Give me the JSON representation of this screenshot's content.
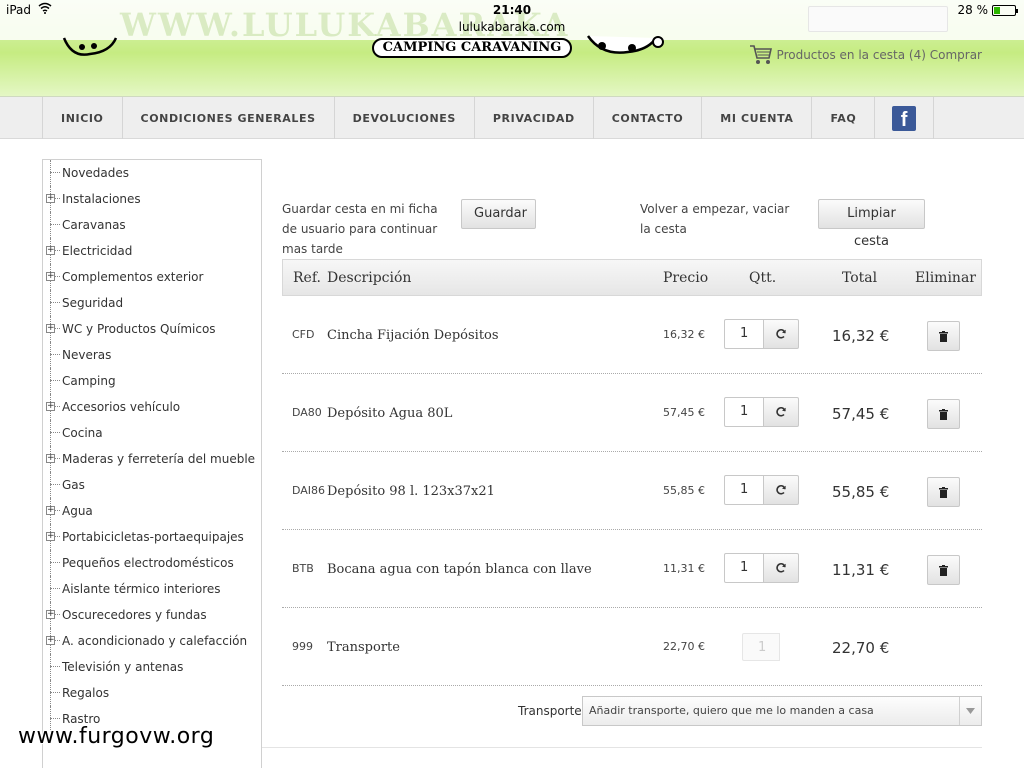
{
  "status_bar": {
    "device": "iPad",
    "time": "21:40",
    "url": "lulukabaraka.com",
    "battery_text": "28 %",
    "battery_level": 0.28,
    "battery_color": "#2db600"
  },
  "header": {
    "domain_banner": "WWW.LULUKABARAKA",
    "logo_subtitle": "CAMPING CARAVANING",
    "cart_text": "Productos en la cesta (4) Comprar",
    "cart_icon": "shopping-cart-icon"
  },
  "nav": {
    "items": [
      "INICIO",
      "CONDICIONES GENERALES",
      "DEVOLUCIONES",
      "PRIVACIDAD",
      "CONTACTO",
      "MI CUENTA",
      "FAQ"
    ],
    "facebook_icon": "facebook-icon",
    "facebook_color": "#3b5998"
  },
  "sidebar": {
    "categories": [
      {
        "label": "Novedades",
        "expandable": false
      },
      {
        "label": "Instalaciones",
        "expandable": true
      },
      {
        "label": "Caravanas",
        "expandable": false
      },
      {
        "label": "Electricidad",
        "expandable": true
      },
      {
        "label": "Complementos exterior",
        "expandable": true
      },
      {
        "label": "Seguridad",
        "expandable": false
      },
      {
        "label": "WC y Productos Químicos",
        "expandable": true
      },
      {
        "label": "Neveras",
        "expandable": false
      },
      {
        "label": "Camping",
        "expandable": false
      },
      {
        "label": "Accesorios vehículo",
        "expandable": true
      },
      {
        "label": "Cocina",
        "expandable": false
      },
      {
        "label": "Maderas y ferretería del mueble",
        "expandable": true
      },
      {
        "label": "Gas",
        "expandable": false
      },
      {
        "label": "Agua",
        "expandable": true
      },
      {
        "label": "Portabicicletas-portaequipajes",
        "expandable": true
      },
      {
        "label": "Pequeños electrodomésticos",
        "expandable": false
      },
      {
        "label": "Aislante térmico interiores",
        "expandable": false
      },
      {
        "label": "Oscurecedores y fundas",
        "expandable": true
      },
      {
        "label": "A. acondicionado y calefacción",
        "expandable": true
      },
      {
        "label": "Televisión y antenas",
        "expandable": false
      },
      {
        "label": "Regalos",
        "expandable": false
      },
      {
        "label": "Rastro",
        "expandable": false
      }
    ]
  },
  "basket": {
    "save_text": "Guardar cesta en mi ficha de usuario para continuar mas tarde",
    "save_button": "Guardar",
    "clear_text": "Volver a empezar, vaciar la cesta",
    "clear_button": "Limpiar cesta",
    "columns": {
      "ref": "Ref.",
      "description": "Descripción",
      "price": "Precio",
      "qty": "Qtt.",
      "total": "Total",
      "remove": "Eliminar"
    },
    "rows": [
      {
        "ref": "CFD",
        "description": "Cincha Fijación Depósitos",
        "price": "16,32 €",
        "qty": "1",
        "total": "16,32 €",
        "editable": true
      },
      {
        "ref": "DA80",
        "description": "Depósito Agua 80L",
        "price": "57,45 €",
        "qty": "1",
        "total": "57,45 €",
        "editable": true
      },
      {
        "ref": "DAI86",
        "description": "Depósito 98 l. 123x37x21",
        "price": "55,85 €",
        "qty": "1",
        "total": "55,85 €",
        "editable": true
      },
      {
        "ref": "BTB",
        "description": "Bocana agua con tapón blanca con llave",
        "price": "11,31 €",
        "qty": "1",
        "total": "11,31 €",
        "editable": true
      },
      {
        "ref": "999",
        "description": "Transporte",
        "price": "22,70 €",
        "qty": "1",
        "total": "22,70 €",
        "editable": false
      }
    ],
    "transport_label": "Transporte:",
    "transport_selected": "Añadir transporte, quiero que me lo manden a casa"
  },
  "watermark": "www.furgovw.org"
}
